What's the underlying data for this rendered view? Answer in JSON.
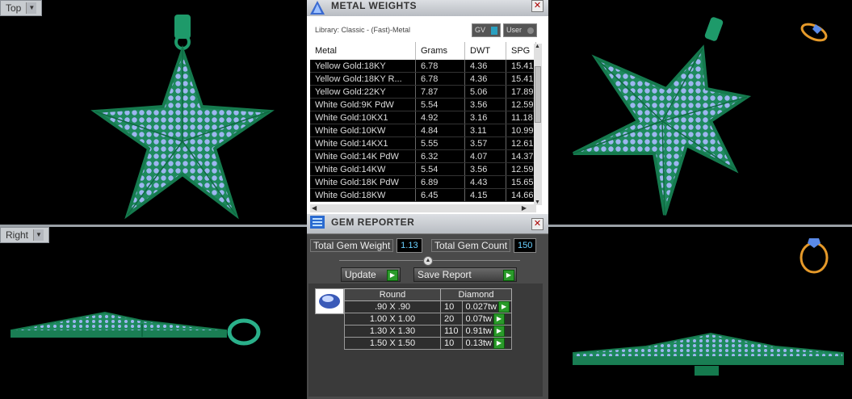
{
  "viewports": {
    "top_label": "Top",
    "right_label": "Right"
  },
  "metal_weights": {
    "title": "METAL WEIGHTS",
    "library": "Library: Classic - (Fast)-Metal",
    "gv_label": "GV",
    "user_label": "User",
    "columns": [
      "Metal",
      "Grams",
      "DWT",
      "SPG"
    ],
    "rows": [
      [
        "Yellow Gold:18KY",
        "6.78",
        "4.36",
        "15.41"
      ],
      [
        "Yellow Gold:18KY R...",
        "6.78",
        "4.36",
        "15.41"
      ],
      [
        "Yellow Gold:22KY",
        "7.87",
        "5.06",
        "17.89"
      ],
      [
        "White Gold:9K PdW",
        "5.54",
        "3.56",
        "12.59"
      ],
      [
        "White Gold:10KX1",
        "4.92",
        "3.16",
        "11.18"
      ],
      [
        "White Gold:10KW",
        "4.84",
        "3.11",
        "10.99"
      ],
      [
        "White Gold:14KX1",
        "5.55",
        "3.57",
        "12.61"
      ],
      [
        "White Gold:14K PdW",
        "6.32",
        "4.07",
        "14.37"
      ],
      [
        "White Gold:14KW",
        "5.54",
        "3.56",
        "12.59"
      ],
      [
        "White Gold:18K PdW",
        "6.89",
        "4.43",
        "15.65"
      ],
      [
        "White Gold:18KW",
        "6.45",
        "4.15",
        "14.66"
      ]
    ]
  },
  "gem_reporter": {
    "title": "GEM REPORTER",
    "total_weight_label": "Total Gem Weight",
    "total_weight_value": "1.13",
    "total_count_label": "Total Gem Count",
    "total_count_value": "150",
    "update_label": "Update",
    "save_label": "Save Report",
    "shape_header": "Round",
    "material_header": "Diamond",
    "gems": [
      [
        ".90 X .90",
        "10",
        "0.027tw"
      ],
      [
        "1.00 X 1.00",
        "20",
        "0.07tw"
      ],
      [
        "1.30 X 1.30",
        "110",
        "0.91tw"
      ],
      [
        "1.50 X 1.50",
        "10",
        "0.13tw"
      ]
    ]
  },
  "colors": {
    "metal": "#1a8a5a",
    "gem": "#8aa8e8",
    "accent": "#2a9a2a"
  }
}
